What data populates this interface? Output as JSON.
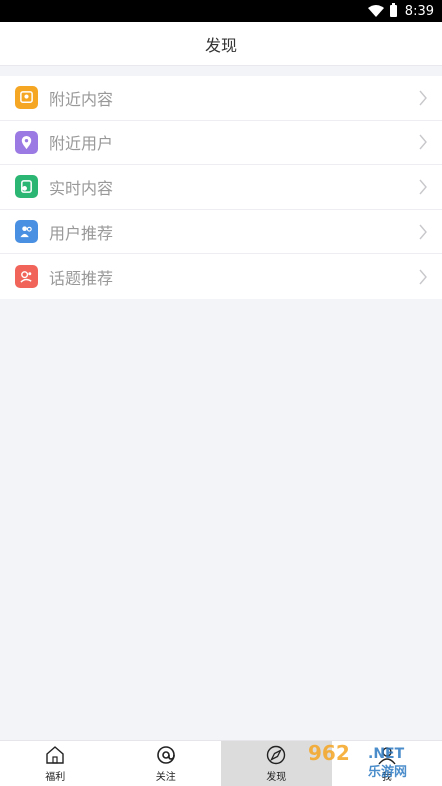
{
  "status_bar": {
    "time": "8:39"
  },
  "header": {
    "title": "发现"
  },
  "list": [
    {
      "label": "附近内容",
      "icon": "nearby-content-icon",
      "color": "#f5a623"
    },
    {
      "label": "附近用户",
      "icon": "location-pin-icon",
      "color": "#9b7be3"
    },
    {
      "label": "实时内容",
      "icon": "realtime-content-icon",
      "color": "#2bb673"
    },
    {
      "label": "用户推荐",
      "icon": "users-icon",
      "color": "#4a90e2"
    },
    {
      "label": "话题推荐",
      "icon": "topic-icon",
      "color": "#f0645a"
    }
  ],
  "tabbar": {
    "tabs": [
      {
        "label": "福利",
        "icon": "home-icon"
      },
      {
        "label": "关注",
        "icon": "at-icon"
      },
      {
        "label": "发现",
        "icon": "compass-icon",
        "active": true
      },
      {
        "label": "我",
        "icon": "profile-icon"
      }
    ]
  },
  "watermark": {
    "text": "962.NET",
    "subtext": "乐游网"
  }
}
